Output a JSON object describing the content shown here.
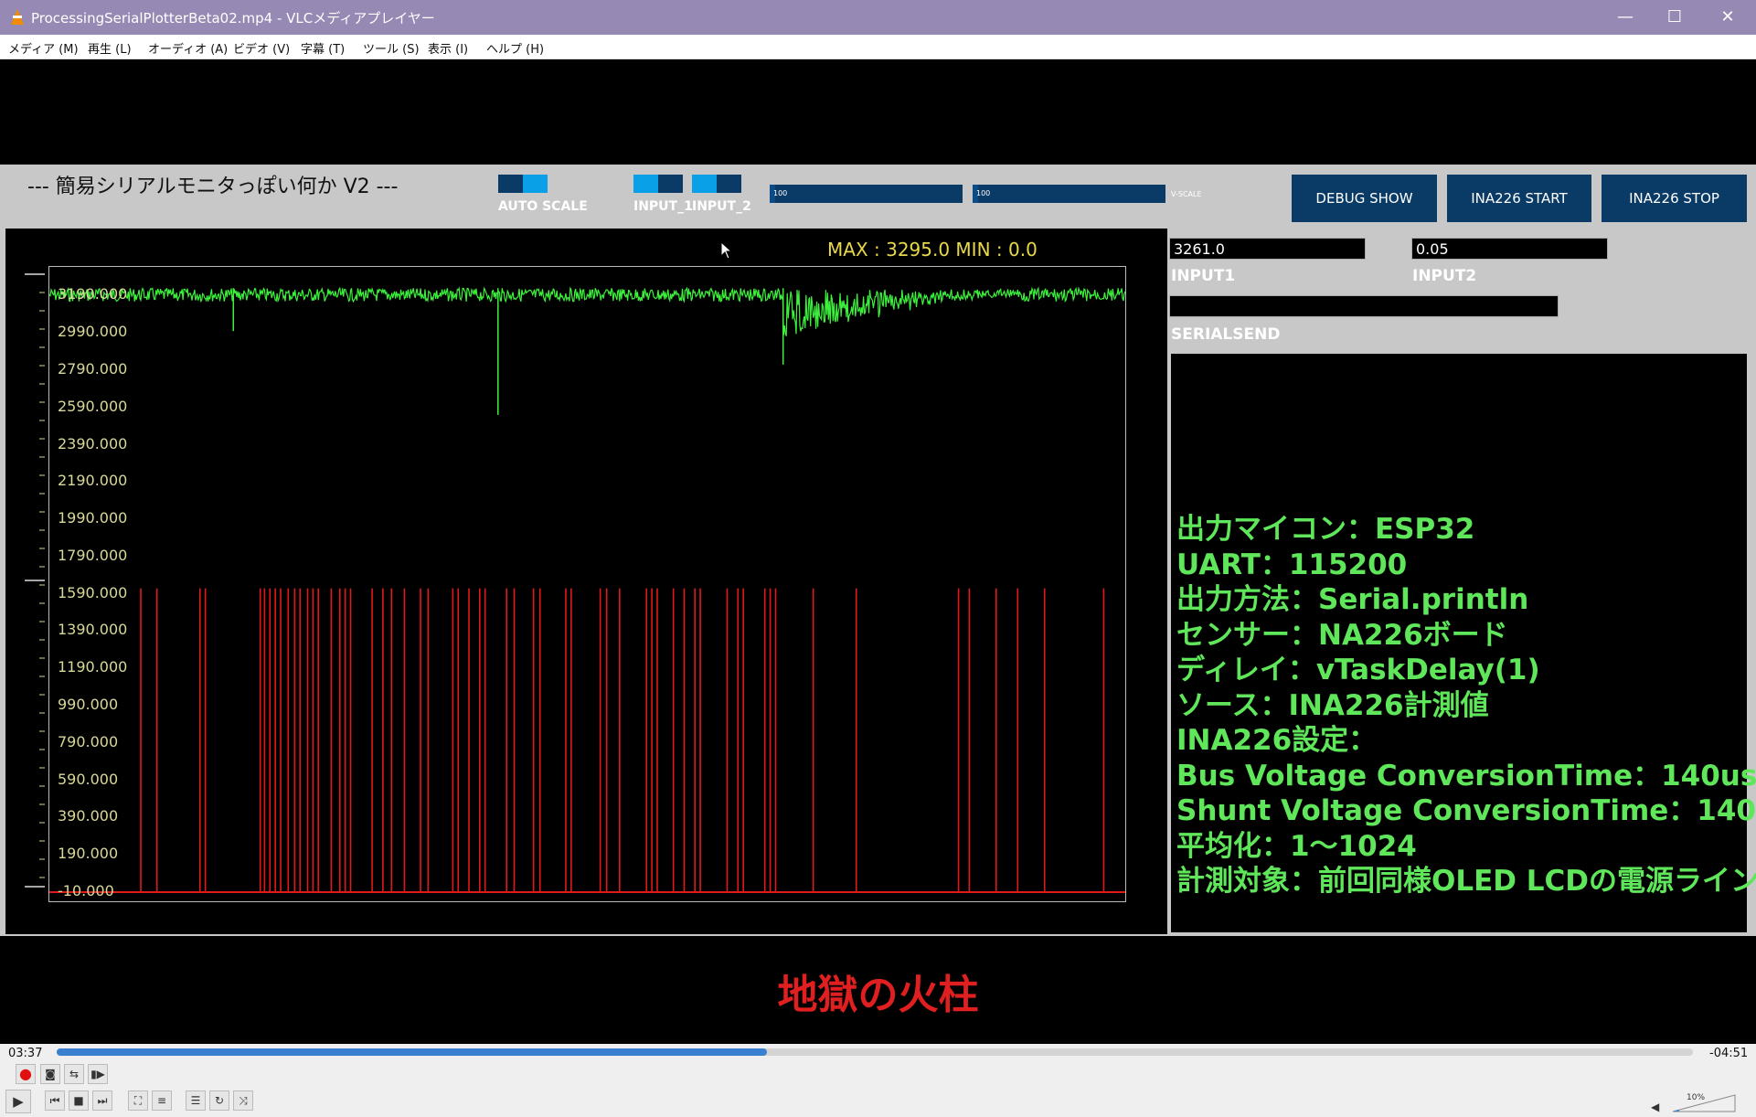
{
  "window": {
    "title": "ProcessingSerialPlotterBeta02.mp4 - VLCメディアプレイヤー",
    "minimize": "—",
    "maximize": "☐",
    "close": "✕"
  },
  "menu": [
    "メディア (M)",
    "再生 (L)",
    "オーディオ (A)",
    "ビデオ (V)",
    "字幕 (T)",
    "ツール (S)",
    "表示 (I)",
    "ヘルプ (H)"
  ],
  "app": {
    "title": "--- 簡易シリアルモニタっぽい何か V2 ---",
    "auto_scale_label": "AUTO SCALE",
    "input1_label": "INPUT_1",
    "input2_label": "INPUT_2",
    "slider1_value": "100",
    "slider2_value": "100",
    "vscale_label": "V-SCALE",
    "buttons": {
      "debug": "DEBUG SHOW",
      "start": "INA226 START",
      "stop": "INA226 STOP"
    },
    "maxmin": "MAX : 3295.0   MIN : 0.0",
    "input1_value": "3261.0",
    "input2_value": "0.05",
    "input1_caption": "INPUT1",
    "input2_caption": "INPUT2",
    "serialsend_caption": "SERIALSEND",
    "serialsend_value": "",
    "console_lines": [
      "出力マイコン：ESP32",
      "UART：115200",
      "出力方法：Serial.println",
      "センサー：NA226ボード",
      "ディレイ：vTaskDelay(1)",
      "ソース：INA226計測値",
      "INA226設定：",
      "Bus Voltage ConversionTime：140us",
      "Shunt Voltage ConversionTime：140",
      "平均化：1〜1024",
      "計測対象：前回同様OLED LCDの電源ライン"
    ]
  },
  "chart_data": {
    "type": "line",
    "title": "",
    "xlabel": "",
    "ylabel": "",
    "ylim": [
      -10,
      3295
    ],
    "y_ticks": [
      "3190.000",
      "2990.000",
      "2790.000",
      "2590.000",
      "2390.000",
      "2190.000",
      "1990.000",
      "1790.000",
      "1590.000",
      "1390.000",
      "1190.000",
      "990.000",
      "790.000",
      "590.000",
      "390.000",
      "190.000",
      "-10.000"
    ],
    "series": [
      {
        "color": "#3cf03c",
        "baseline": 3230,
        "noise": 45,
        "spikes": [
          [
            0.171,
            3000
          ],
          [
            0.417,
            2550
          ],
          [
            0.682,
            2820
          ]
        ],
        "dense_region": [
          0.682,
          0.9,
          2980
        ]
      },
      {
        "color": "#e01a1a",
        "baseline": -10,
        "spike_top": 1620,
        "spikes_x": [
          0.085,
          0.1,
          0.14,
          0.145,
          0.196,
          0.2,
          0.205,
          0.21,
          0.215,
          0.222,
          0.228,
          0.233,
          0.24,
          0.245,
          0.25,
          0.262,
          0.27,
          0.275,
          0.28,
          0.3,
          0.31,
          0.318,
          0.33,
          0.345,
          0.352,
          0.375,
          0.38,
          0.39,
          0.4,
          0.405,
          0.425,
          0.432,
          0.45,
          0.456,
          0.48,
          0.485,
          0.512,
          0.518,
          0.53,
          0.555,
          0.56,
          0.565,
          0.58,
          0.59,
          0.6,
          0.605,
          0.63,
          0.64,
          0.645,
          0.665,
          0.67,
          0.675,
          0.71,
          0.75,
          0.845,
          0.855,
          0.88,
          0.9,
          0.925,
          0.98
        ]
      }
    ]
  },
  "subtitle": "地獄の火柱",
  "player": {
    "elapsed": "03:37",
    "remaining": "-04:51",
    "progress": 0.4343,
    "volume": "10%"
  }
}
